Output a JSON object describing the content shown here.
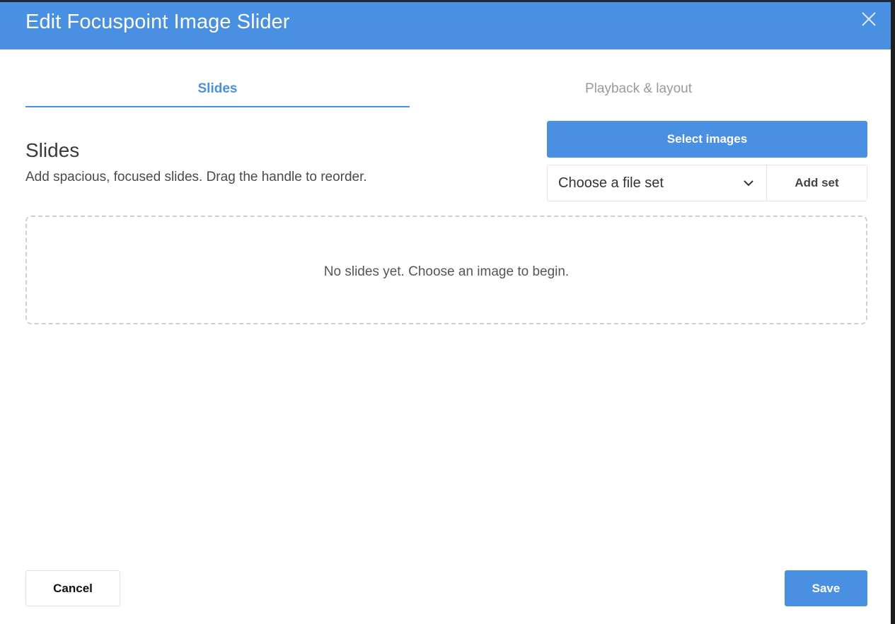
{
  "dialog": {
    "title": "Edit Focuspoint Image Slider",
    "close_icon": "close-icon"
  },
  "tabs": [
    {
      "label": "Slides",
      "active": true
    },
    {
      "label": "Playback & layout",
      "active": false
    }
  ],
  "section": {
    "heading": "Slides",
    "description": "Add spacious, focused slides. Drag the handle to reorder."
  },
  "actions": {
    "select_images_label": "Select images",
    "file_set_placeholder": "Choose a file set",
    "add_set_label": "Add set"
  },
  "empty_state": {
    "message": "No slides yet. Choose an image to begin."
  },
  "footer": {
    "cancel_label": "Cancel",
    "save_label": "Save"
  },
  "colors": {
    "accent": "#4a90e2",
    "inactive_tab": "#9a9a9a"
  }
}
